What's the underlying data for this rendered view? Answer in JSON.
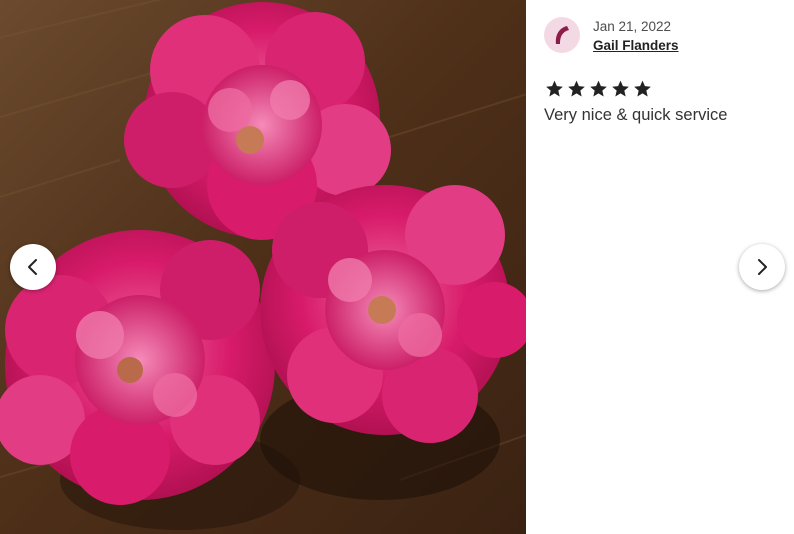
{
  "review": {
    "date": "Jan 21, 2022",
    "reviewer_name": "Gail Flanders",
    "rating": 5,
    "max_rating": 5,
    "text": "Very nice & quick service"
  },
  "photo": {
    "subject_icon": "peony-photo"
  },
  "navigation": {
    "prev_icon": "chevron-left-icon",
    "next_icon": "chevron-right-icon"
  },
  "colors": {
    "star": "#222222",
    "avatar_bg": "#f3d9e4",
    "avatar_mark": "#8c1d4a",
    "peony_pink": "#d81b6a",
    "table_wood": "#4a2c17"
  }
}
